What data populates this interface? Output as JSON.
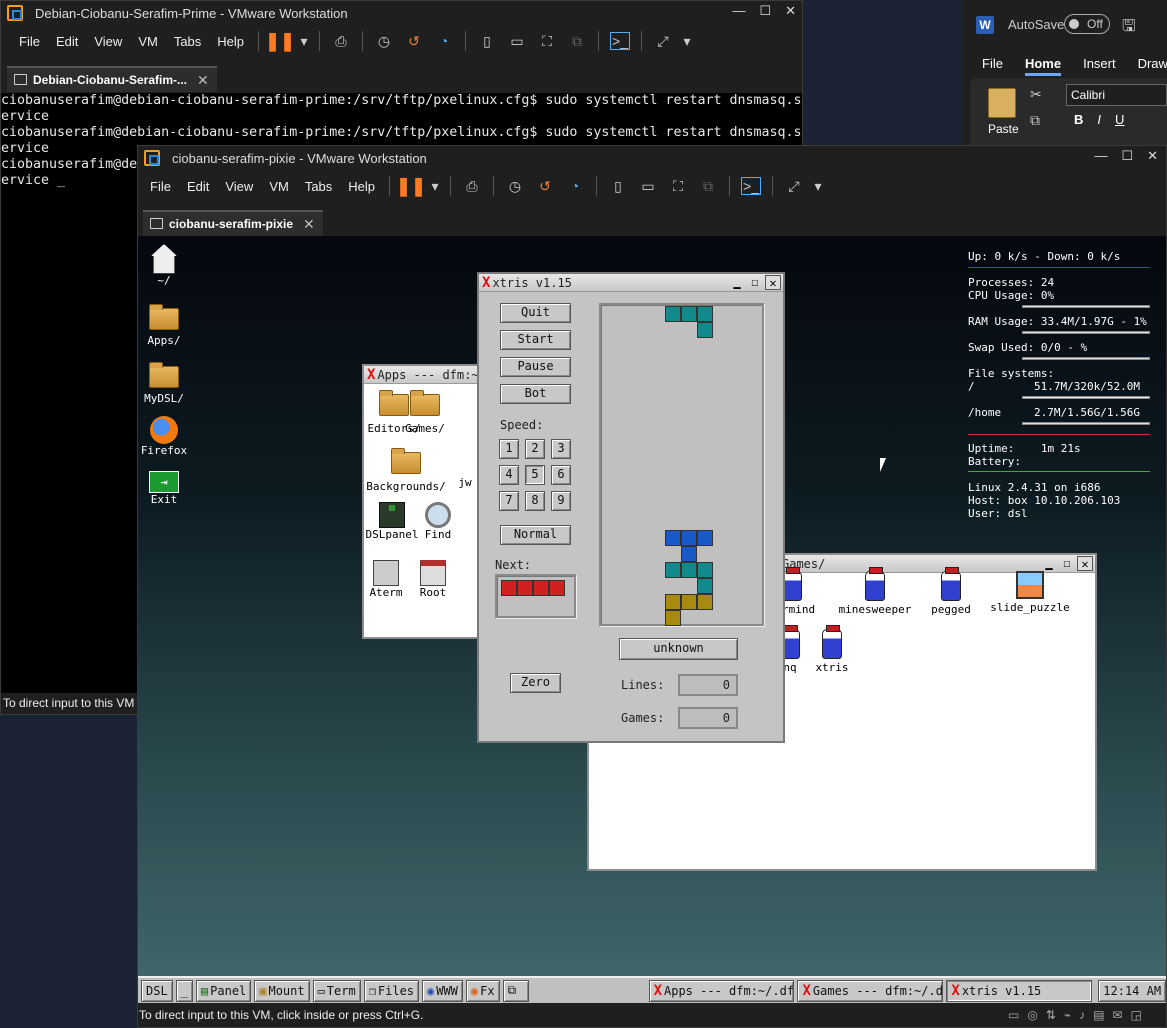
{
  "host_vm": {
    "title": "Debian-Ciobanu-Serafim-Prime - VMware Workstation",
    "menu": [
      "File",
      "Edit",
      "View",
      "VM",
      "Tabs",
      "Help"
    ],
    "tab_label": "Debian-Ciobanu-Serafim-...",
    "terminal_lines": [
      "ciobanuserafim@debian-ciobanu-serafim-prime:/srv/tftp/pxelinux.cfg$ sudo systemctl restart dnsmasq.s",
      "ervice",
      "ciobanuserafim@debian-ciobanu-serafim-prime:/srv/tftp/pxelinux.cfg$ sudo systemctl restart dnsmasq.s",
      "ervice",
      "ciobanuserafim@de",
      "ervice _"
    ],
    "status": "To direct input to this VM"
  },
  "word": {
    "autosave_label": "AutoSave",
    "autosave_state": "Off",
    "tabs": [
      "File",
      "Home",
      "Insert",
      "Draw"
    ],
    "active_tab": "Home",
    "paste_label": "Paste",
    "font_name": "Calibri",
    "format_buttons": [
      "B",
      "I",
      "U"
    ]
  },
  "guest_vm": {
    "title": "ciobanu-serafim-pixie - VMware Workstation",
    "menu": [
      "File",
      "Edit",
      "View",
      "VM",
      "Tabs",
      "Help"
    ],
    "tab_label": "ciobanu-serafim-pixie",
    "status": "To direct input to this VM, click inside or press Ctrl+G."
  },
  "desktop_icons": [
    {
      "label": "~/",
      "icon": "home-icon"
    },
    {
      "label": "Apps/",
      "icon": "folder-icon"
    },
    {
      "label": "MyDSL/",
      "icon": "folder-icon"
    },
    {
      "label": "Firefox",
      "icon": "firefox-icon"
    },
    {
      "label": "Exit",
      "icon": "exit-icon"
    }
  ],
  "apps_window": {
    "title": "Apps --- dfm:~/.d",
    "items": [
      "Editors/",
      "Games/",
      "Backgrounds/",
      "jw",
      "DSLpanel",
      "Find",
      "Aterm",
      "Root"
    ]
  },
  "games_window": {
    "title": "Games/",
    "items": [
      "termind",
      "minesweeper",
      "pegged",
      "slide_puzzle",
      "nq",
      "xtris"
    ]
  },
  "xtris": {
    "title": "xtris v1.15",
    "buttons": {
      "quit": "Quit",
      "start": "Start",
      "pause": "Pause",
      "bot": "Bot",
      "normal": "Normal",
      "zero": "Zero"
    },
    "speed_label": "Speed:",
    "speeds": [
      "1",
      "2",
      "3",
      "4",
      "5",
      "6",
      "7",
      "8",
      "9"
    ],
    "selected_speed": "5",
    "next_label": "Next:",
    "player": "unknown",
    "lines_label": "Lines:",
    "lines": "0",
    "games_label": "Games:",
    "games": "0"
  },
  "conky": {
    "net": "Up: 0 k/s - Down: 0 k/s",
    "processes": "Processes: 24",
    "cpu": "CPU Usage: 0%",
    "ram": "RAM Usage: 33.4M/1.97G - 1%",
    "swap": "Swap Used: 0/0 - %",
    "fs_header": "File systems:",
    "fs_root_label": "/",
    "fs_root": "51.7M/320k/52.0M",
    "fs_home_label": "/home",
    "fs_home": "2.7M/1.56G/1.56G",
    "uptime": "Uptime:    1m 21s",
    "battery": "Battery:",
    "kernel": "Linux 2.4.31 on i686",
    "host": "Host: box 10.10.206.103",
    "user": "User: dsl"
  },
  "taskbar": {
    "start": "DSL",
    "dash": "_",
    "launchers": [
      "Panel",
      "Mount",
      "Term",
      "Files",
      "WWW",
      "Fx"
    ],
    "tasks": [
      "Apps --- dfm:~/.dfmde",
      "Games --- dfm:~/.dfmc",
      "xtris v1.15"
    ],
    "clock": "12:14 AM"
  },
  "colors": {
    "vmware_accent": "#f0a020",
    "dsl_blue": "#2a8ad8",
    "xtris_red": "#e01010"
  }
}
